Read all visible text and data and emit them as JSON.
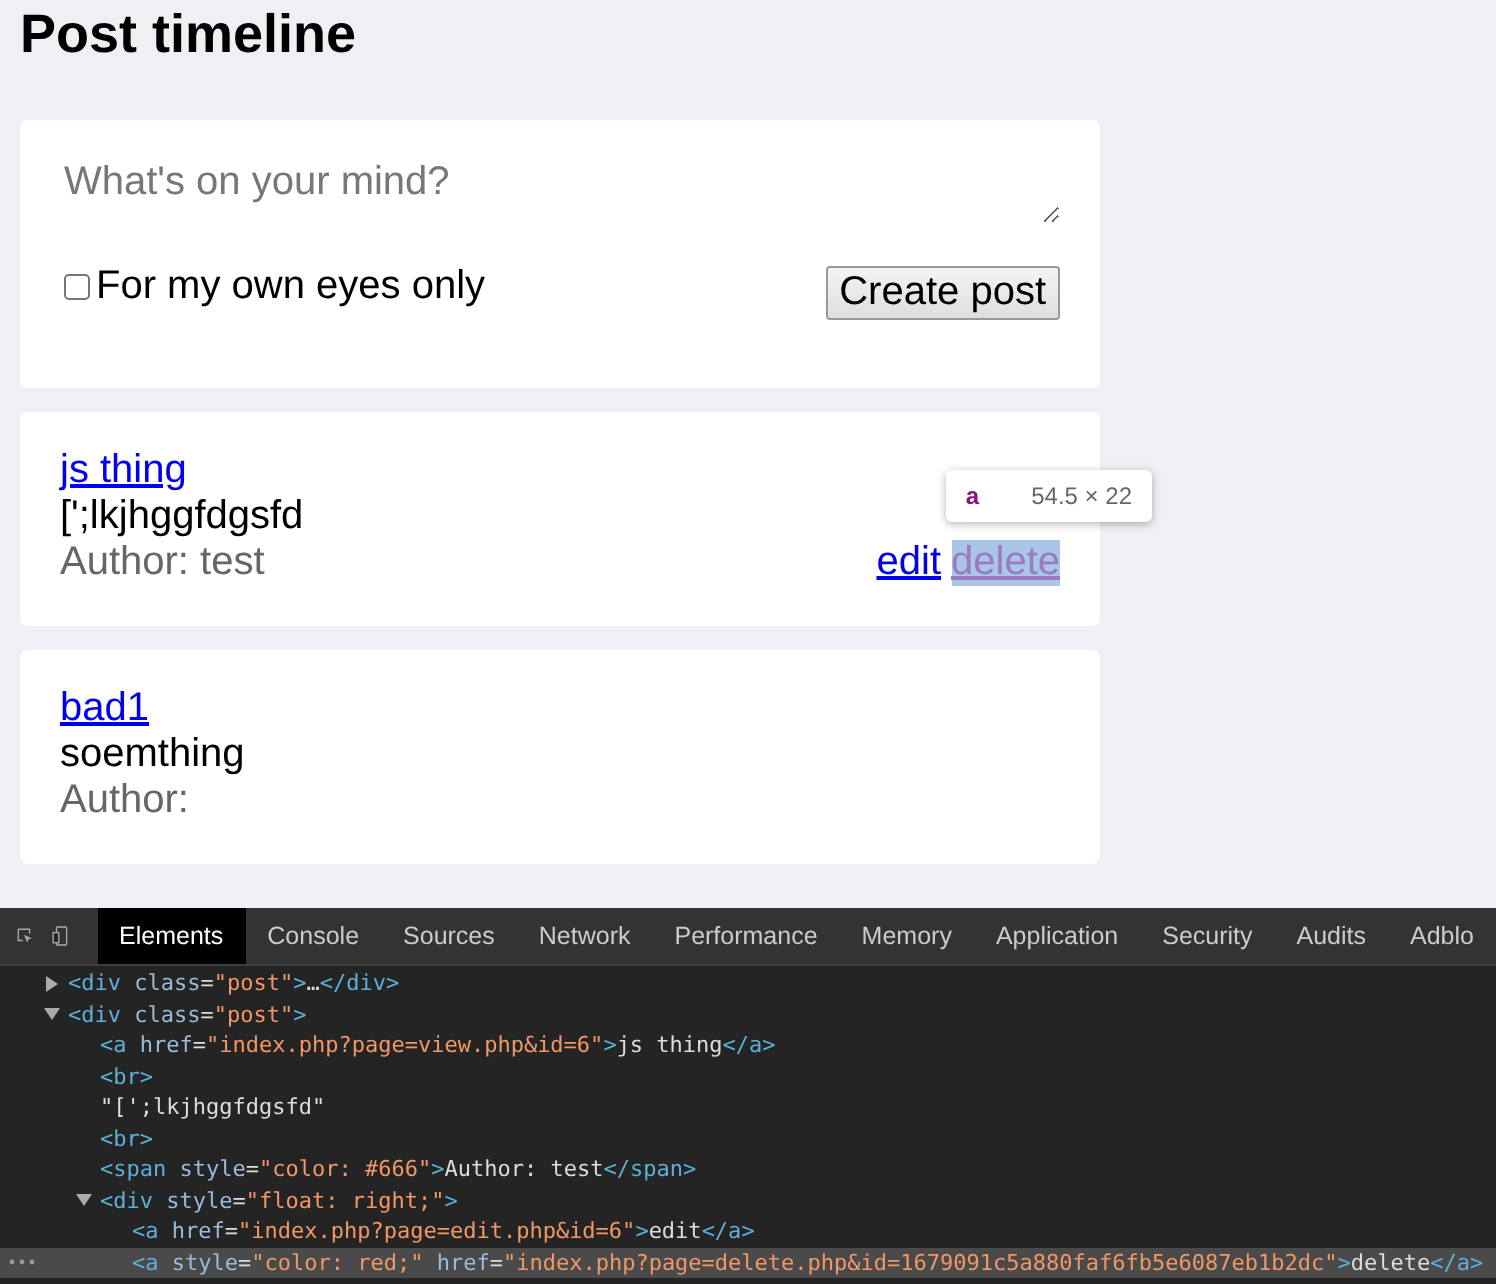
{
  "page_title": "Post timeline",
  "composer": {
    "placeholder": "What's on your mind?",
    "private_label": "For my own eyes only",
    "private_checked": false,
    "submit": "Create post"
  },
  "posts": [
    {
      "title": "js thing",
      "body": "[';lkjhggfdgsfd",
      "author": "Author: test",
      "actions": [
        {
          "label": "edit",
          "highlighted": false
        },
        {
          "label": "delete",
          "highlighted": true
        }
      ],
      "tooltip": {
        "tag": "a",
        "size": "54.5 × 22"
      }
    },
    {
      "title": "bad1",
      "body": "soemthing",
      "author": "Author:"
    }
  ],
  "devtools": {
    "tabs": [
      {
        "label": "Elements",
        "selected": true
      },
      {
        "label": "Console",
        "selected": false
      },
      {
        "label": "Sources",
        "selected": false
      },
      {
        "label": "Network",
        "selected": false
      },
      {
        "label": "Performance",
        "selected": false
      },
      {
        "label": "Memory",
        "selected": false
      },
      {
        "label": "Application",
        "selected": false
      },
      {
        "label": "Security",
        "selected": false
      },
      {
        "label": "Audits",
        "selected": false
      },
      {
        "label": "Adblo",
        "selected": false
      }
    ],
    "tree": [
      {
        "text": "<div class=\"post\">…</div>",
        "expanded": false,
        "selected": false
      },
      {
        "text": "<div class=\"post\">",
        "expanded": true,
        "selected": false,
        "children": [
          {
            "text": "<a href=\"index.php?page=view.php&id=6\">js thing</a>",
            "selected": false
          },
          {
            "text": "<br>",
            "selected": false
          },
          {
            "text": "\"[';lkjhggfdgsfd\"",
            "selected": false
          },
          {
            "text": "<br>",
            "selected": false
          },
          {
            "text": "<span style=\"color: #666\">Author: test</span>",
            "selected": false
          },
          {
            "text": "<div style=\"float: right;\">",
            "expanded": true,
            "selected": false,
            "children": [
              {
                "text": "<a href=\"index.php?page=edit.php&id=6\">edit</a>",
                "selected": false
              },
              {
                "text": "<a style=\"color: red;\" href=\"index.php?page=delete.php&id=1679091c5a880faf6fb5e6087eb1b2dc\">delete</a>",
                "selected": true
              }
            ]
          }
        ]
      }
    ]
  }
}
